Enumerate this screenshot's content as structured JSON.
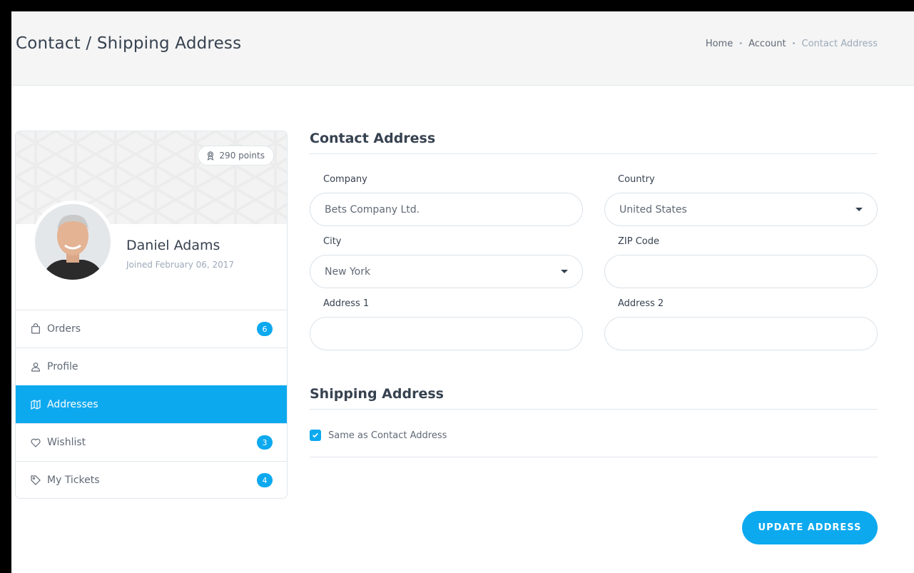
{
  "header": {
    "title": "Contact / Shipping Address",
    "breadcrumb": [
      "Home",
      "Account",
      "Contact Address"
    ]
  },
  "profile": {
    "points": "290 points",
    "name": "Daniel Adams",
    "joined": "Joined February 06, 2017"
  },
  "nav": {
    "items": [
      {
        "label": "Orders",
        "icon": "bag-icon",
        "badge": "6"
      },
      {
        "label": "Profile",
        "icon": "user-icon",
        "badge": null
      },
      {
        "label": "Addresses",
        "icon": "map-icon",
        "badge": null,
        "active": true
      },
      {
        "label": "Wishlist",
        "icon": "heart-icon",
        "badge": "3"
      },
      {
        "label": "My Tickets",
        "icon": "tag-icon",
        "badge": "4"
      }
    ]
  },
  "contact": {
    "title": "Contact Address",
    "company_label": "Company",
    "company_value": "Bets Company Ltd.",
    "country_label": "Country",
    "country_value": "United States",
    "city_label": "City",
    "city_value": "New York",
    "zip_label": "ZIP Code",
    "zip_value": "",
    "address1_label": "Address 1",
    "address1_value": "",
    "address2_label": "Address 2",
    "address2_value": ""
  },
  "shipping": {
    "title": "Shipping Address",
    "same_as_label": "Same as Contact Address",
    "same_as_checked": true
  },
  "actions": {
    "update_label": "UPDATE ADDRESS"
  },
  "colors": {
    "accent": "#0da9ef"
  }
}
